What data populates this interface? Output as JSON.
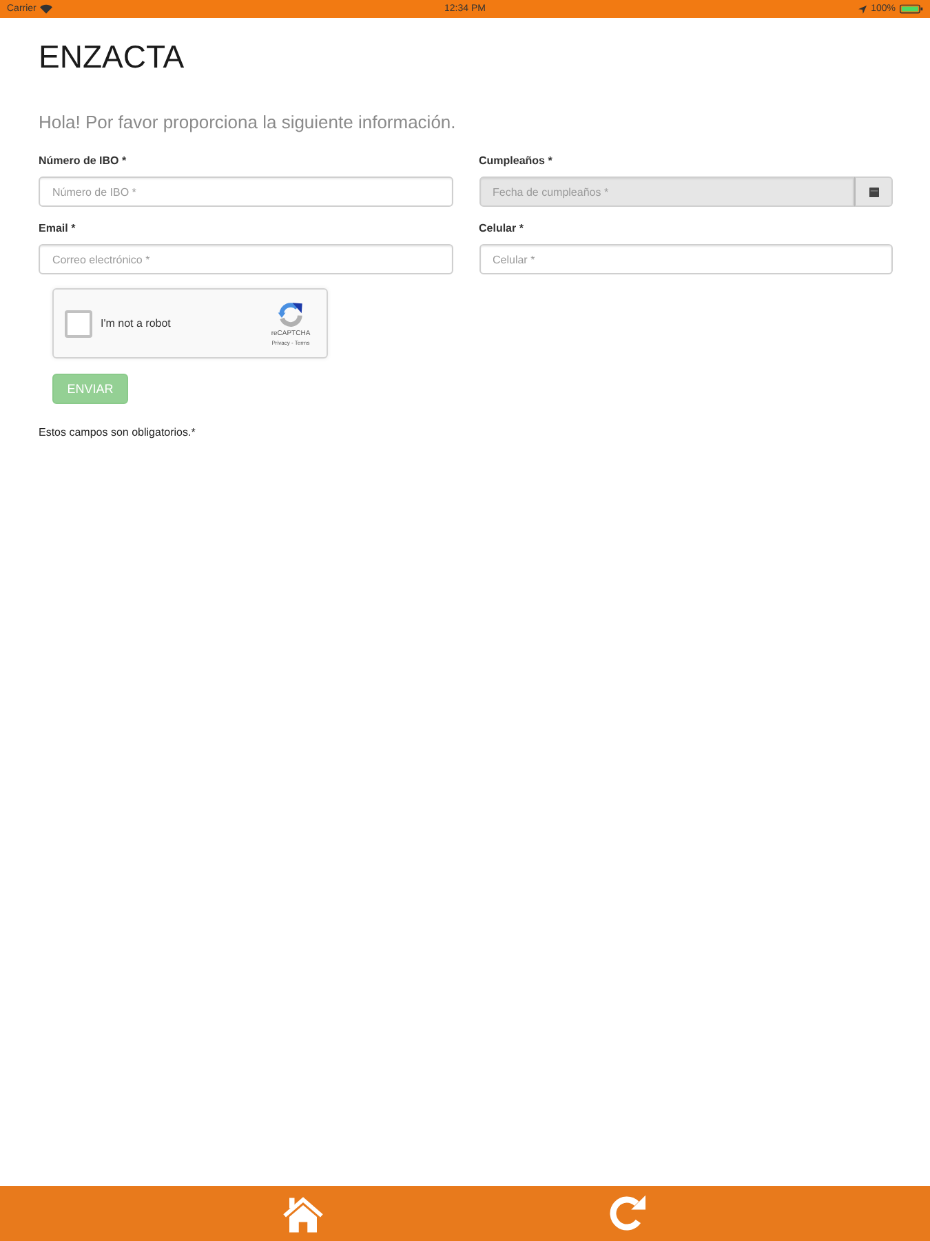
{
  "status_bar": {
    "carrier": "Carrier",
    "time": "12:34 PM",
    "battery": "100%"
  },
  "header": {
    "title": "ENZACTA"
  },
  "form": {
    "intro": "Hola! Por favor proporciona la siguiente información.",
    "fields": [
      {
        "kind": "text",
        "label": "Número de IBO *",
        "placeholder": "Número de IBO *",
        "disabled": false
      },
      {
        "kind": "date",
        "label": "Cumpleaños *",
        "placeholder": "Fecha de cumpleaños *",
        "disabled": true
      },
      {
        "kind": "text",
        "label": "Email *",
        "placeholder": "Correo electrónico *",
        "disabled": false
      },
      {
        "kind": "text",
        "label": "Celular *",
        "placeholder": "Celular *",
        "disabled": false
      }
    ],
    "captcha": {
      "label": "I'm not a robot",
      "checked": false,
      "brand": "reCAPTCHA",
      "links": "Privacy - Terms"
    },
    "submit": {
      "label": "ENVIAR",
      "disabled": true
    },
    "note": "Estos campos son obligatorios.*"
  }
}
